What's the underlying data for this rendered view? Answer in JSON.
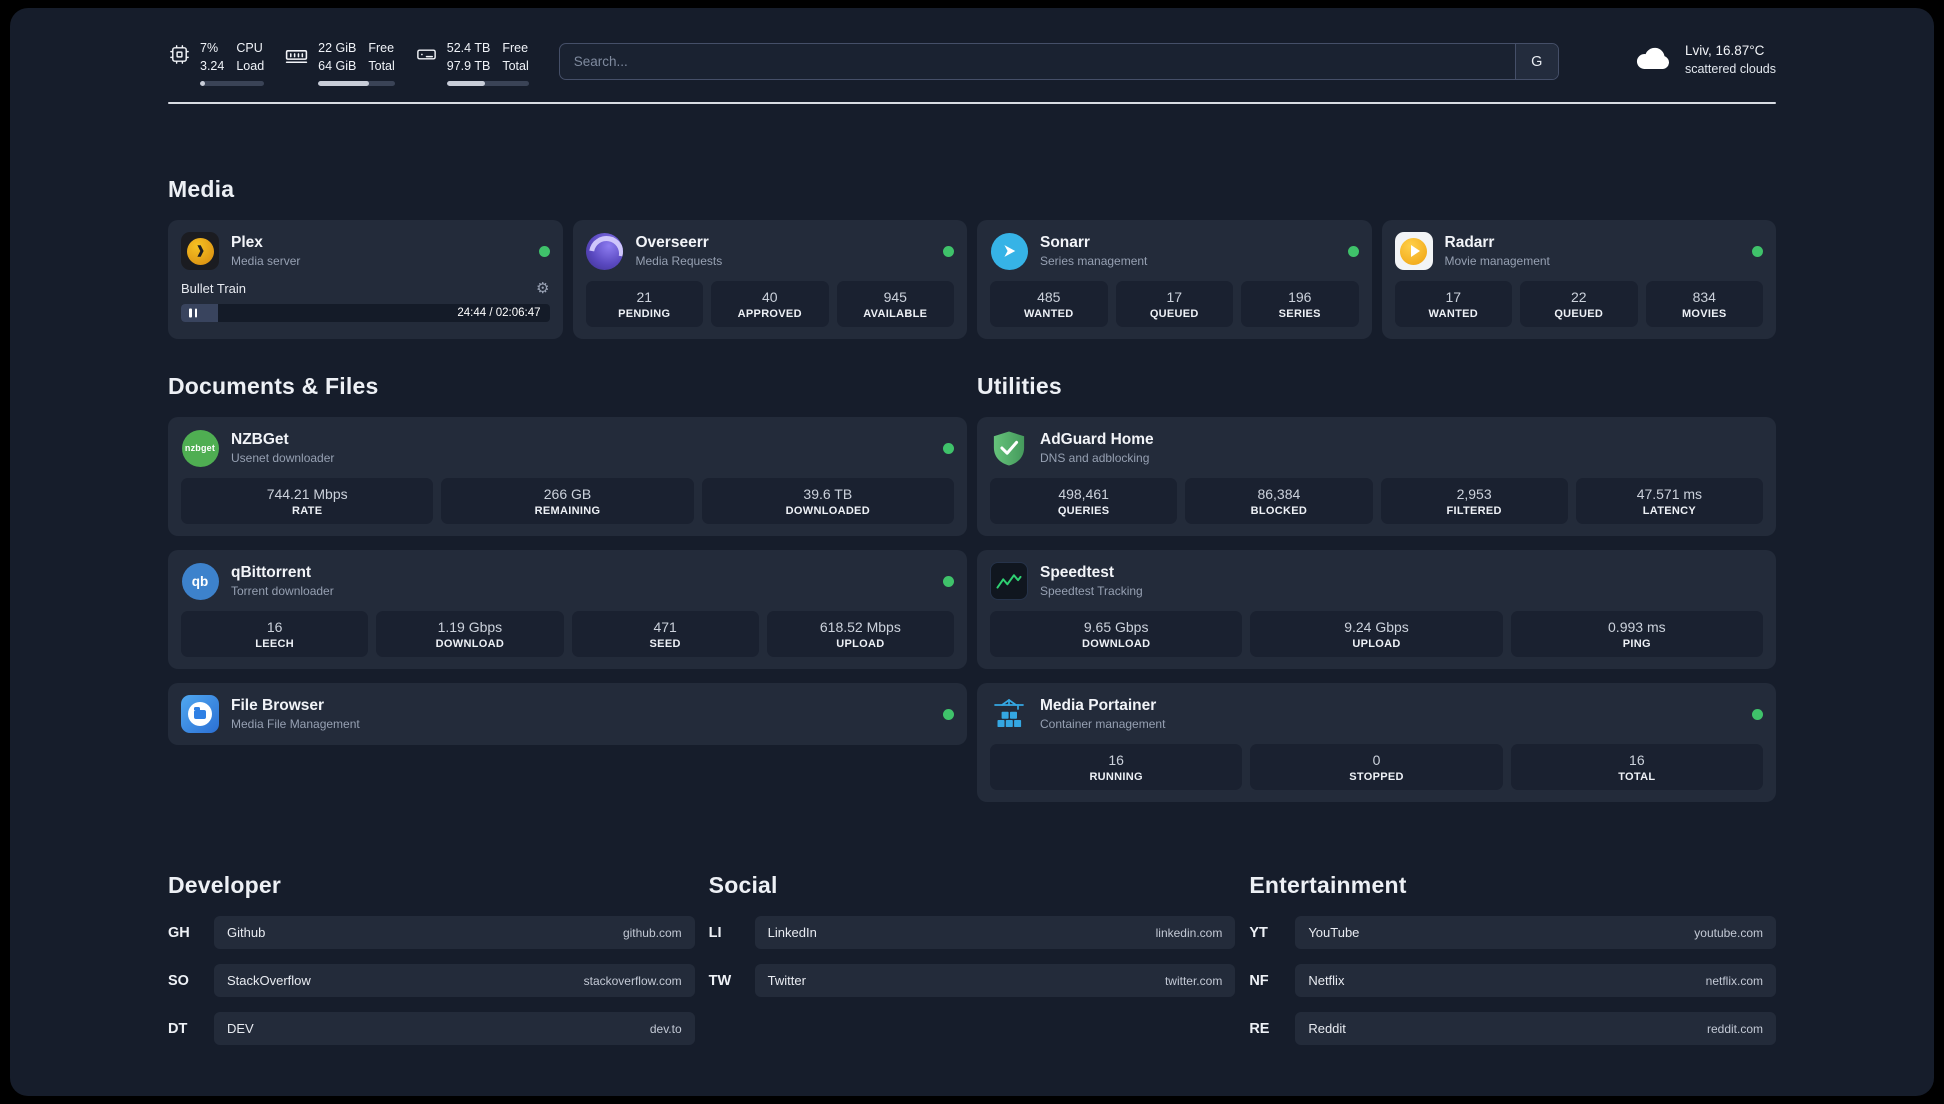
{
  "colors": {
    "background": "#161d2b",
    "card": "#232b3a",
    "tile": "#1a2130",
    "status_online": "#3fc26a"
  },
  "topbar": {
    "metrics": [
      {
        "icon": "cpu-icon",
        "value_top": "7%",
        "value_bottom": "3.24",
        "label_top": "CPU",
        "label_bottom": "Load",
        "progress_pct": 8
      },
      {
        "icon": "ram-icon",
        "value_top": "22 GiB",
        "value_bottom": "64 GiB",
        "label_top": "Free",
        "label_bottom": "Total",
        "progress_pct": 66
      },
      {
        "icon": "disk-icon",
        "value_top": "52.4 TB",
        "value_bottom": "97.9 TB",
        "label_top": "Free",
        "label_bottom": "Total",
        "progress_pct": 47
      }
    ],
    "search": {
      "placeholder": "Search...",
      "engine_badge": "G"
    },
    "weather": {
      "icon": "cloud-icon",
      "location": "Lviv, 16.87°C",
      "condition": "scattered clouds"
    }
  },
  "media": {
    "title": "Media",
    "plex": {
      "name": "Plex",
      "subtitle": "Media server",
      "status": "online",
      "now_playing": "Bullet Train",
      "time_display": "24:44 / 02:06:47",
      "progress_pct": 10
    },
    "overseerr": {
      "name": "Overseerr",
      "subtitle": "Media Requests",
      "status": "online",
      "stats": [
        {
          "value": "21",
          "label": "PENDING"
        },
        {
          "value": "40",
          "label": "APPROVED"
        },
        {
          "value": "945",
          "label": "AVAILABLE"
        }
      ]
    },
    "sonarr": {
      "name": "Sonarr",
      "subtitle": "Series management",
      "status": "online",
      "stats": [
        {
          "value": "485",
          "label": "WANTED"
        },
        {
          "value": "17",
          "label": "QUEUED"
        },
        {
          "value": "196",
          "label": "SERIES"
        }
      ]
    },
    "radarr": {
      "name": "Radarr",
      "subtitle": "Movie management",
      "status": "online",
      "stats": [
        {
          "value": "17",
          "label": "WANTED"
        },
        {
          "value": "22",
          "label": "QUEUED"
        },
        {
          "value": "834",
          "label": "MOVIES"
        }
      ]
    }
  },
  "documents": {
    "title": "Documents & Files",
    "nzbget": {
      "name": "NZBGet",
      "subtitle": "Usenet downloader",
      "status": "online",
      "icon_text": "nzbget",
      "stats": [
        {
          "value": "744.21 Mbps",
          "label": "RATE"
        },
        {
          "value": "266 GB",
          "label": "REMAINING"
        },
        {
          "value": "39.6 TB",
          "label": "DOWNLOADED"
        }
      ]
    },
    "qbittorrent": {
      "name": "qBittorrent",
      "subtitle": "Torrent downloader",
      "status": "online",
      "icon_text": "qb",
      "stats": [
        {
          "value": "16",
          "label": "LEECH"
        },
        {
          "value": "1.19 Gbps",
          "label": "DOWNLOAD"
        },
        {
          "value": "471",
          "label": "SEED"
        },
        {
          "value": "618.52 Mbps",
          "label": "UPLOAD"
        }
      ]
    },
    "filebrowser": {
      "name": "File Browser",
      "subtitle": "Media File Management",
      "status": "online"
    }
  },
  "utilities": {
    "title": "Utilities",
    "adguard": {
      "name": "AdGuard Home",
      "subtitle": "DNS and adblocking",
      "stats": [
        {
          "value": "498,461",
          "label": "QUERIES"
        },
        {
          "value": "86,384",
          "label": "BLOCKED"
        },
        {
          "value": "2,953",
          "label": "FILTERED"
        },
        {
          "value": "47.571 ms",
          "label": "LATENCY"
        }
      ]
    },
    "speedtest": {
      "name": "Speedtest",
      "subtitle": "Speedtest Tracking",
      "stats": [
        {
          "value": "9.65 Gbps",
          "label": "DOWNLOAD"
        },
        {
          "value": "9.24 Gbps",
          "label": "UPLOAD"
        },
        {
          "value": "0.993 ms",
          "label": "PING"
        }
      ]
    },
    "portainer": {
      "name": "Media Portainer",
      "subtitle": "Container management",
      "status": "online",
      "stats": [
        {
          "value": "16",
          "label": "RUNNING"
        },
        {
          "value": "0",
          "label": "STOPPED"
        },
        {
          "value": "16",
          "label": "TOTAL"
        }
      ]
    }
  },
  "bookmarks": [
    {
      "title": "Developer",
      "items": [
        {
          "abbr": "GH",
          "name": "Github",
          "domain": "github.com"
        },
        {
          "abbr": "SO",
          "name": "StackOverflow",
          "domain": "stackoverflow.com"
        },
        {
          "abbr": "DT",
          "name": "DEV",
          "domain": "dev.to"
        }
      ]
    },
    {
      "title": "Social",
      "items": [
        {
          "abbr": "LI",
          "name": "LinkedIn",
          "domain": "linkedin.com"
        },
        {
          "abbr": "TW",
          "name": "Twitter",
          "domain": "twitter.com"
        }
      ]
    },
    {
      "title": "Entertainment",
      "items": [
        {
          "abbr": "YT",
          "name": "YouTube",
          "domain": "youtube.com"
        },
        {
          "abbr": "NF",
          "name": "Netflix",
          "domain": "netflix.com"
        },
        {
          "abbr": "RE",
          "name": "Reddit",
          "domain": "reddit.com"
        }
      ]
    }
  ]
}
